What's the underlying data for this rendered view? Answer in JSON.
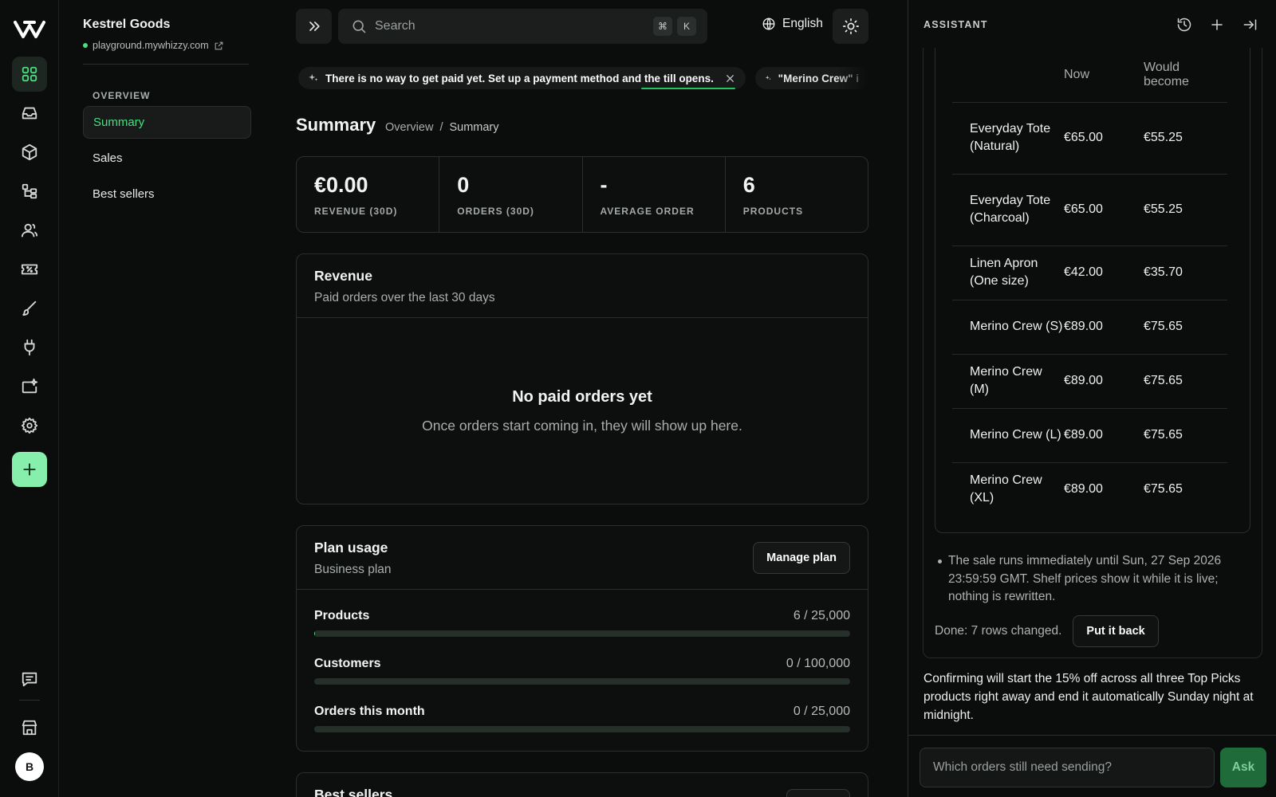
{
  "store": {
    "name": "Kestrel Goods",
    "url": "playground.mywhizzy.com"
  },
  "rail": {
    "items": [
      "dashboard-icon",
      "inbox-icon",
      "box-icon",
      "workflow-icon",
      "users-icon",
      "ticket-icon",
      "brush-icon",
      "plug-icon",
      "sparkle-folder-icon",
      "gear-icon",
      "plus-icon"
    ],
    "bottom": [
      "chat-icon",
      "storefront-icon"
    ],
    "avatar": "B"
  },
  "nav": {
    "section": "OVERVIEW",
    "items": [
      {
        "label": "Summary",
        "active": true
      },
      {
        "label": "Sales",
        "active": false
      },
      {
        "label": "Best sellers",
        "active": false
      }
    ]
  },
  "topbar": {
    "search_placeholder": "Search",
    "kbd1": "⌘",
    "kbd2": "K",
    "language": "English"
  },
  "notices": [
    "There is no way to get paid yet. Set up a payment method and the till opens.",
    "\"Merino Crew\" i"
  ],
  "page": {
    "title": "Summary",
    "breadcrumb": [
      "Overview",
      "/",
      "Summary"
    ]
  },
  "stats": [
    {
      "value": "€0.00",
      "label": "REVENUE (30D)"
    },
    {
      "value": "0",
      "label": "ORDERS (30D)"
    },
    {
      "value": "-",
      "label": "AVERAGE ORDER"
    },
    {
      "value": "6",
      "label": "PRODUCTS"
    }
  ],
  "revenue": {
    "title": "Revenue",
    "subtitle": "Paid orders over the last 30 days",
    "empty_title": "No paid orders yet",
    "empty_subtitle": "Once orders start coming in, they will show up here."
  },
  "plan": {
    "title": "Plan usage",
    "subtitle": "Business plan",
    "manage_label": "Manage plan",
    "usage": [
      {
        "label": "Products",
        "value": "6 / 25,000",
        "fraction": 0.00024
      },
      {
        "label": "Customers",
        "value": "0 / 100,000",
        "fraction": 0
      },
      {
        "label": "Orders this month",
        "value": "0 / 25,000",
        "fraction": 0
      }
    ]
  },
  "bestsellers": {
    "title": "Best sellers"
  },
  "assistant": {
    "title": "ASSISTANT",
    "table": {
      "headers": [
        "",
        "Now",
        "Would become"
      ],
      "rows": [
        {
          "product": "Everyday Tote (Natural)",
          "now": "€65.00",
          "new": "€55.25"
        },
        {
          "product": "Everyday Tote (Charcoal)",
          "now": "€65.00",
          "new": "€55.25"
        },
        {
          "product": "Linen Apron (One size)",
          "now": "€42.00",
          "new": "€35.70"
        },
        {
          "product": "Merino Crew (S)",
          "now": "€89.00",
          "new": "€75.65"
        },
        {
          "product": "Merino Crew (M)",
          "now": "€89.00",
          "new": "€75.65"
        },
        {
          "product": "Merino Crew (L)",
          "now": "€89.00",
          "new": "€75.65"
        },
        {
          "product": "Merino Crew (XL)",
          "now": "€89.00",
          "new": "€75.65"
        }
      ]
    },
    "note": "The sale runs immediately until Sun, 27 Sep 2026 23:59:59 GMT. Shelf prices show it while it is live; nothing is rewritten.",
    "done_text": "Done: 7 rows changed.",
    "put_back_label": "Put it back",
    "confirm_text": "Confirming will start the 15% off across all three Top Picks products right away and end it automatically Sunday night at midnight.",
    "input_placeholder": "Which orders still need sending?",
    "ask_label": "Ask"
  },
  "colors": {
    "accent": "#4ade80",
    "add_button": "#86efac",
    "ask_button": "#1f6b3a",
    "background": "#0b0d0c"
  }
}
